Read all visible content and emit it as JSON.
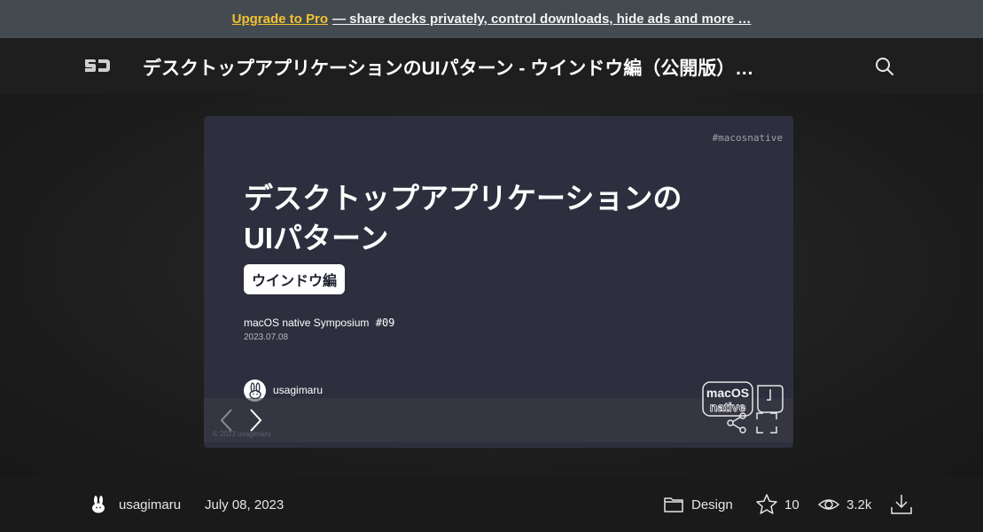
{
  "promo": {
    "link_text": "Upgrade to Pro",
    "rest_text": "— share decks privately, control downloads, hide ads and more …"
  },
  "header": {
    "logo_text": "SD",
    "deck_title": "デスクトップアプリケーションのUIパターン - ウインドウ編（公開版）…",
    "search_icon": "search-icon"
  },
  "slide": {
    "hashtag": "#macosnative",
    "title_line1": "デスクトップアプリケーションの",
    "title_line2": "UIパターン",
    "chip": "ウインドウ編",
    "event_name": "macOS native Symposium",
    "event_number": "#09",
    "event_date": "2023.07.08",
    "author": "usagimaru",
    "copyright": "© 2023 usagimaru",
    "badge_line1": "macOS",
    "badge_line2": "native"
  },
  "footer": {
    "author": "usagimaru",
    "date": "July 08, 2023",
    "category": "Design",
    "stars": "10",
    "views": "3.2k"
  },
  "colors": {
    "promo_bg": "#434b50",
    "promo_link": "#f5c131",
    "slide_bg": "#2d2f3e",
    "footer_bg": "#1a1a1a"
  }
}
